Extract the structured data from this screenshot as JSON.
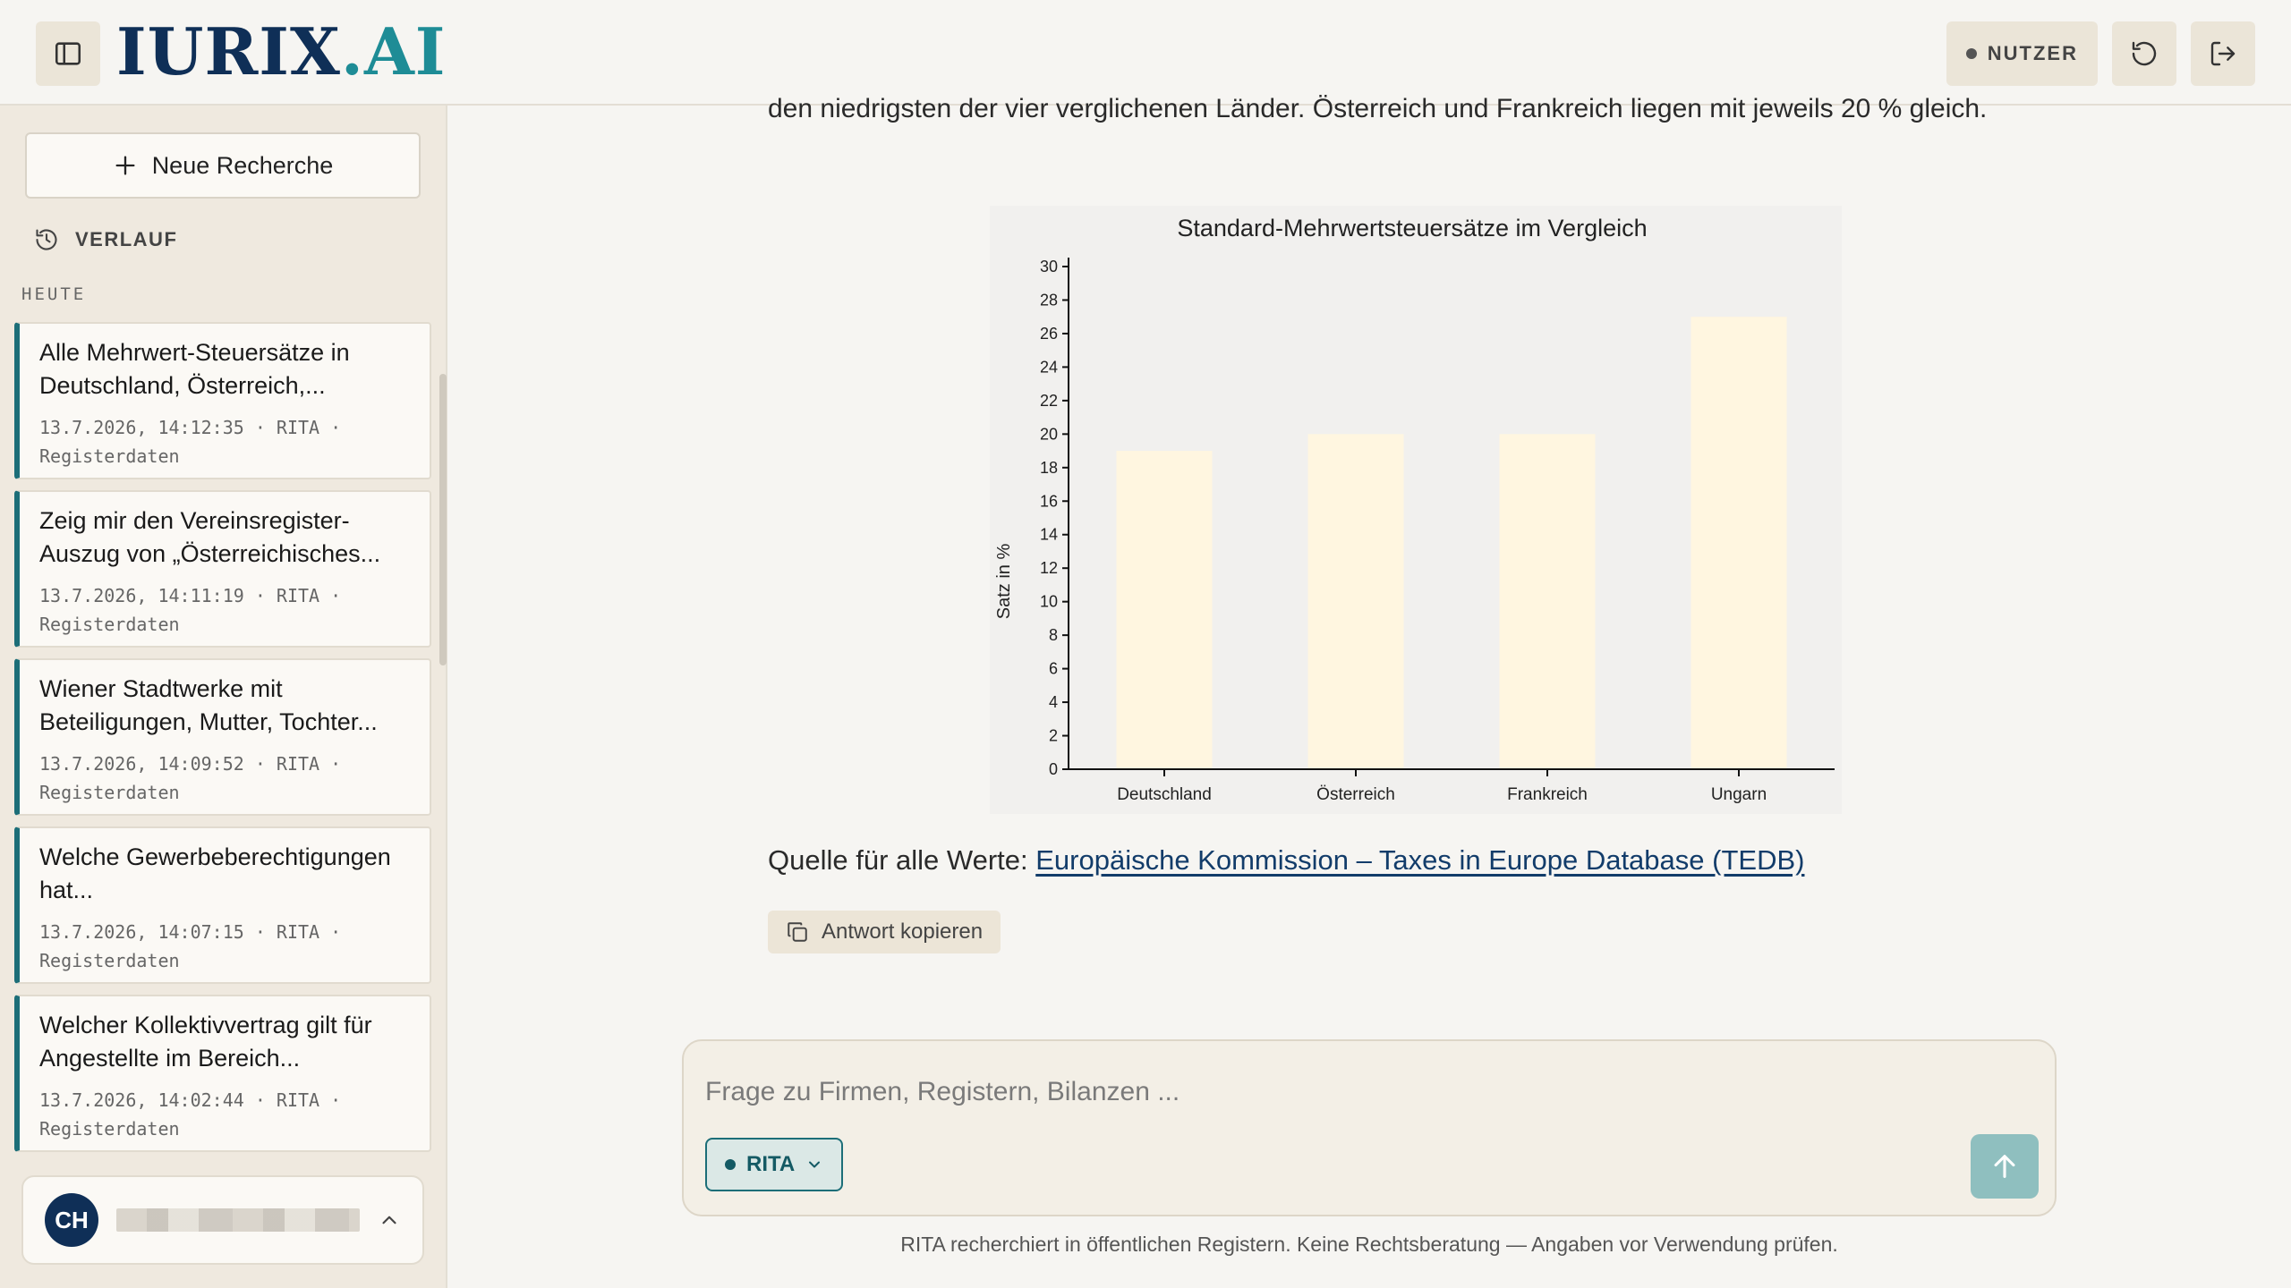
{
  "header": {
    "logo_main": "IURIX",
    "logo_dot": ".",
    "logo_ai": "AI",
    "user_label": "NUTZER"
  },
  "sidebar": {
    "new_research_label": "Neue Recherche",
    "history_label": "VERLAUF",
    "section_today": "HEUTE",
    "items": [
      {
        "title": "Alle Mehrwert-Steuersätze in Deutschland, Österreich,...",
        "meta": "13.7.2026, 14:12:35 · RITA · Registerdaten"
      },
      {
        "title": "Zeig mir den Vereinsregister-Auszug von „Österreichisches...",
        "meta": "13.7.2026, 14:11:19 · RITA · Registerdaten"
      },
      {
        "title": "Wiener Stadtwerke mit Beteiligungen, Mutter, Tochter...",
        "meta": "13.7.2026, 14:09:52 · RITA · Registerdaten"
      },
      {
        "title": "Welche Gewerbeberechtigungen hat...",
        "meta": "13.7.2026, 14:07:15 · RITA · Registerdaten"
      },
      {
        "title": "Welcher Kollektivvertrag gilt für Angestellte im Bereich...",
        "meta": "13.7.2026, 14:02:44 · RITA · Registerdaten"
      }
    ],
    "user_initials": "CH"
  },
  "answer": {
    "text_partial": "den niedrigsten der vier verglichenen Länder. Österreich und Frankreich liegen mit jeweils 20 % gleich.",
    "source_prefix": "Quelle für alle Werte: ",
    "source_link": "Europäische Kommission – Taxes in Europe Database (TEDB)",
    "copy_label": "Antwort kopieren"
  },
  "chart_data": {
    "type": "bar",
    "title": "Standard-Mehrwertsteuersätze im Vergleich",
    "xlabel": "",
    "ylabel": "Satz in %",
    "categories": [
      "Deutschland",
      "Österreich",
      "Frankreich",
      "Ungarn"
    ],
    "values": [
      19,
      20,
      20,
      27
    ],
    "ylim": [
      0,
      30
    ],
    "yticks": [
      0,
      2,
      4,
      6,
      8,
      10,
      12,
      14,
      16,
      18,
      20,
      22,
      24,
      26,
      28,
      30
    ],
    "bar_color": "#fff6e0",
    "grid": false,
    "legend": "none"
  },
  "composer": {
    "placeholder": "Frage zu Firmen, Registern, Bilanzen ...",
    "model_label": "RITA",
    "disclaimer": "RITA recherchiert in öffentlichen Registern. Keine Rechtsberatung — Angaben vor Verwendung prüfen."
  },
  "colors": {
    "brand_navy": "#0f2f57",
    "brand_teal": "#1e8c96",
    "accent_teal": "#1c6e78",
    "send_button": "#8fbfbf"
  },
  "icons": {
    "sidebar_toggle": "sidebar-panel-icon",
    "refresh": "refresh-icon",
    "logout": "logout-icon",
    "plus": "plus-icon",
    "history": "history-clock-icon",
    "copy": "copy-icon",
    "chevron_up": "chevron-up-icon",
    "chevron_down": "chevron-down-icon",
    "send": "arrow-up-icon"
  }
}
